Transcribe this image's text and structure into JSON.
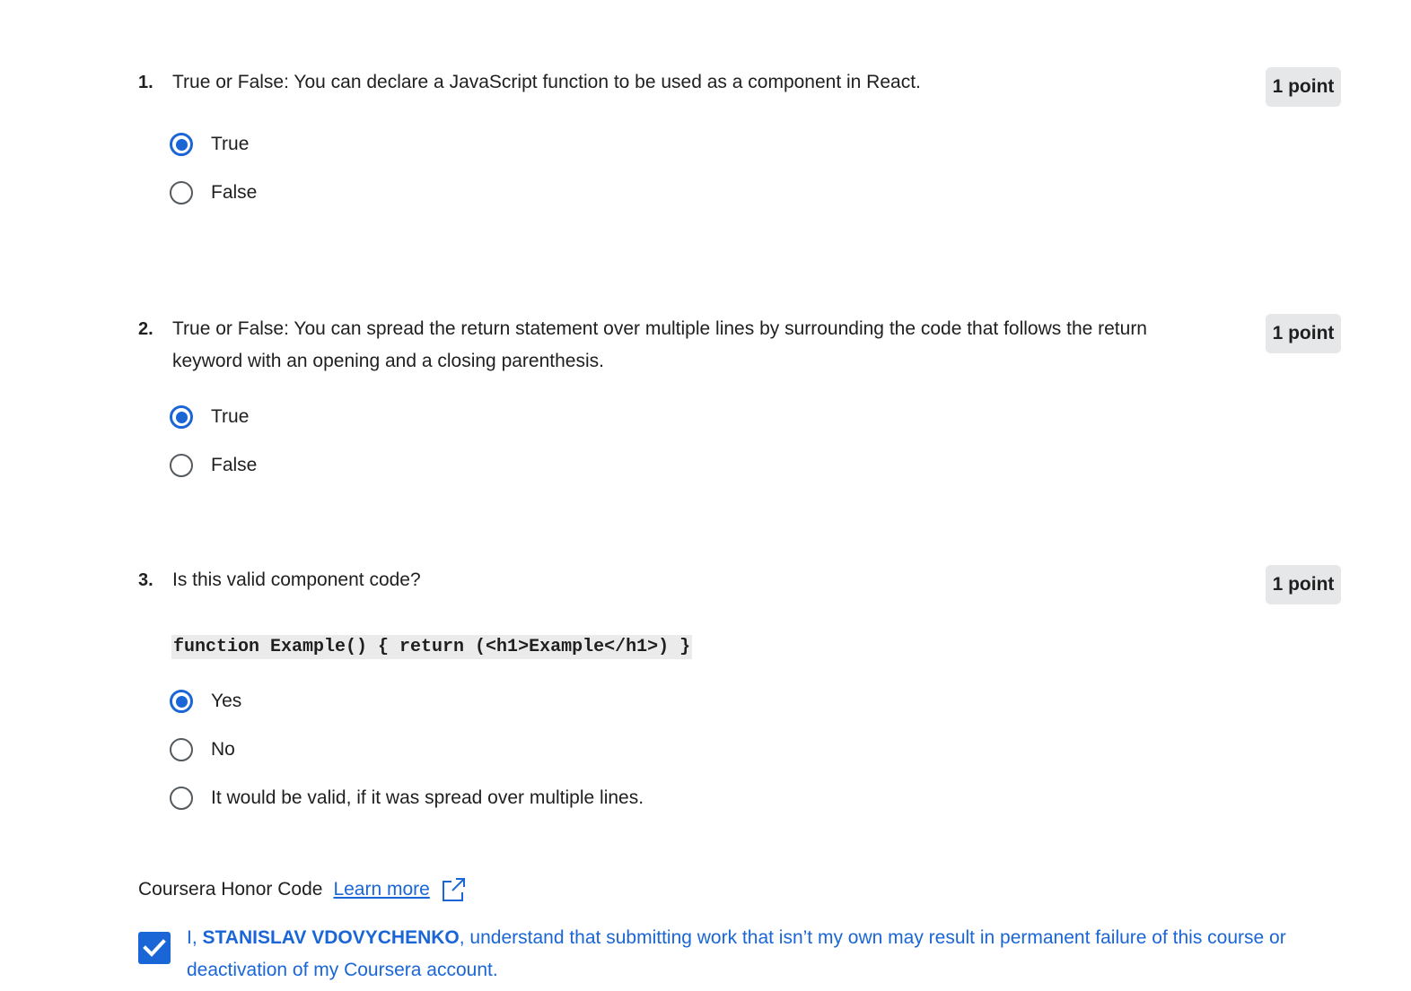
{
  "questions": [
    {
      "number": "1.",
      "text": "True or False: You can declare a JavaScript function to be used as a component in React.",
      "points": "1 point",
      "options": [
        {
          "label": "True",
          "selected": true
        },
        {
          "label": "False",
          "selected": false
        }
      ]
    },
    {
      "number": "2.",
      "text": "True or False: You can spread the return statement over multiple lines by surrounding the code that follows the return keyword with an opening and a closing parenthesis.",
      "points": "1 point",
      "options": [
        {
          "label": "True",
          "selected": true
        },
        {
          "label": "False",
          "selected": false
        }
      ]
    },
    {
      "number": "3.",
      "text": "Is this valid component code?",
      "points": "1 point",
      "code": "function Example() { return (<h1>Example</h1>) }",
      "options": [
        {
          "label": "Yes",
          "selected": true
        },
        {
          "label": "No",
          "selected": false
        },
        {
          "label": "It would be valid, if it was spread over multiple lines.",
          "selected": false
        }
      ]
    }
  ],
  "honor_code": {
    "title": "Coursera Honor Code",
    "learn_more": "Learn more",
    "agreement_prefix": "I, ",
    "name": "STANISLAV VDOVYCHENKO",
    "agreement_suffix": ", understand that submitting work that isn’t my own may result in permanent failure of this course or deactivation of my Coursera account.",
    "checked": true
  },
  "colors": {
    "accent": "#1a66d6",
    "text": "#1f1f1f",
    "badge_bg": "#e5e7e8",
    "code_bg": "#ebebeb"
  }
}
